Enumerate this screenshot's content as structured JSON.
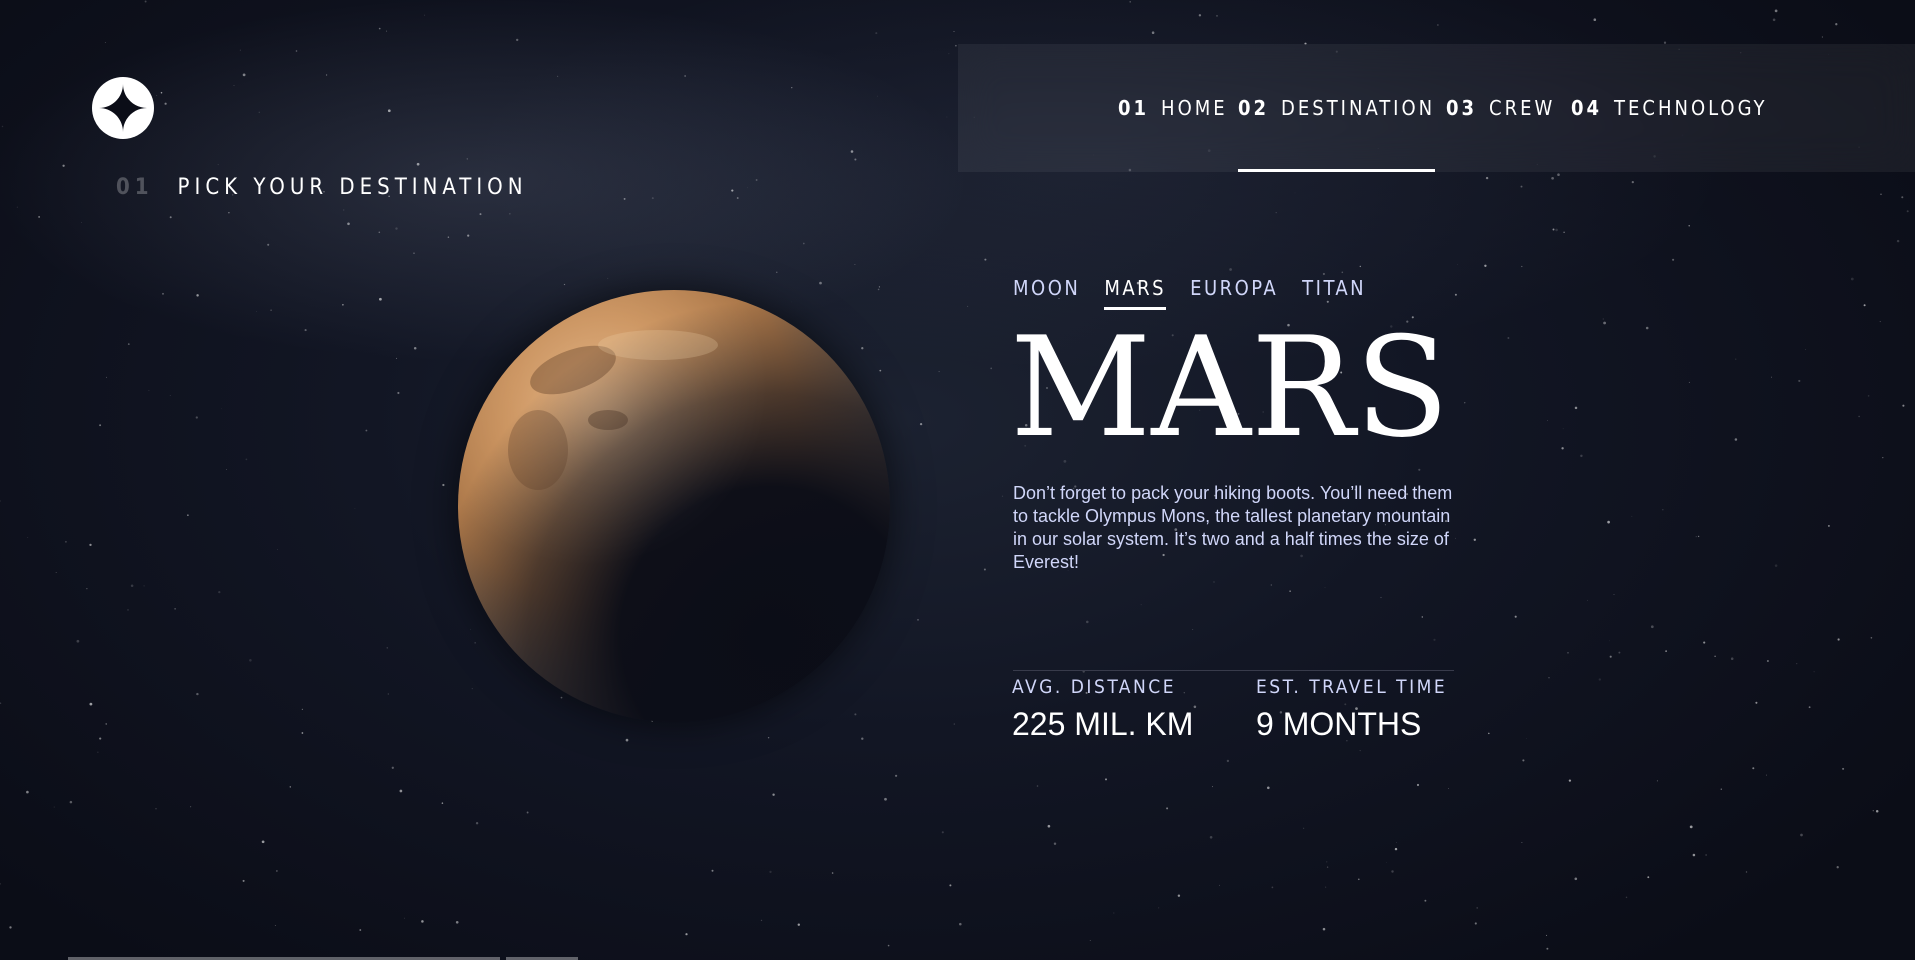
{
  "nav": {
    "items": [
      {
        "num": "01",
        "label": "HOME"
      },
      {
        "num": "02",
        "label": "DESTINATION"
      },
      {
        "num": "03",
        "label": "CREW"
      },
      {
        "num": "04",
        "label": "TECHNOLOGY"
      }
    ],
    "active_index": 1
  },
  "heading": {
    "num": "01",
    "label": "PICK YOUR DESTINATION"
  },
  "tabs": [
    {
      "label": "MOON"
    },
    {
      "label": "MARS"
    },
    {
      "label": "EUROPA"
    },
    {
      "label": "TITAN"
    }
  ],
  "active_tab": 1,
  "destination": {
    "name": "MARS",
    "description": "Don’t forget to pack your hiking boots. You’ll need them to tackle Olympus Mons, the tallest planetary mountain in our solar system. It’s two and a half times the size of Everest!",
    "stats": [
      {
        "label": "AVG. DISTANCE",
        "value": "225 MIL. KM"
      },
      {
        "label": "EST. TRAVEL TIME",
        "value": "9 MONTHS"
      }
    ]
  },
  "icons": {
    "logo": "star-logo-icon"
  },
  "colors": {
    "background": "#0b0d17",
    "accent_text": "#d0d6f9",
    "white": "#ffffff"
  }
}
